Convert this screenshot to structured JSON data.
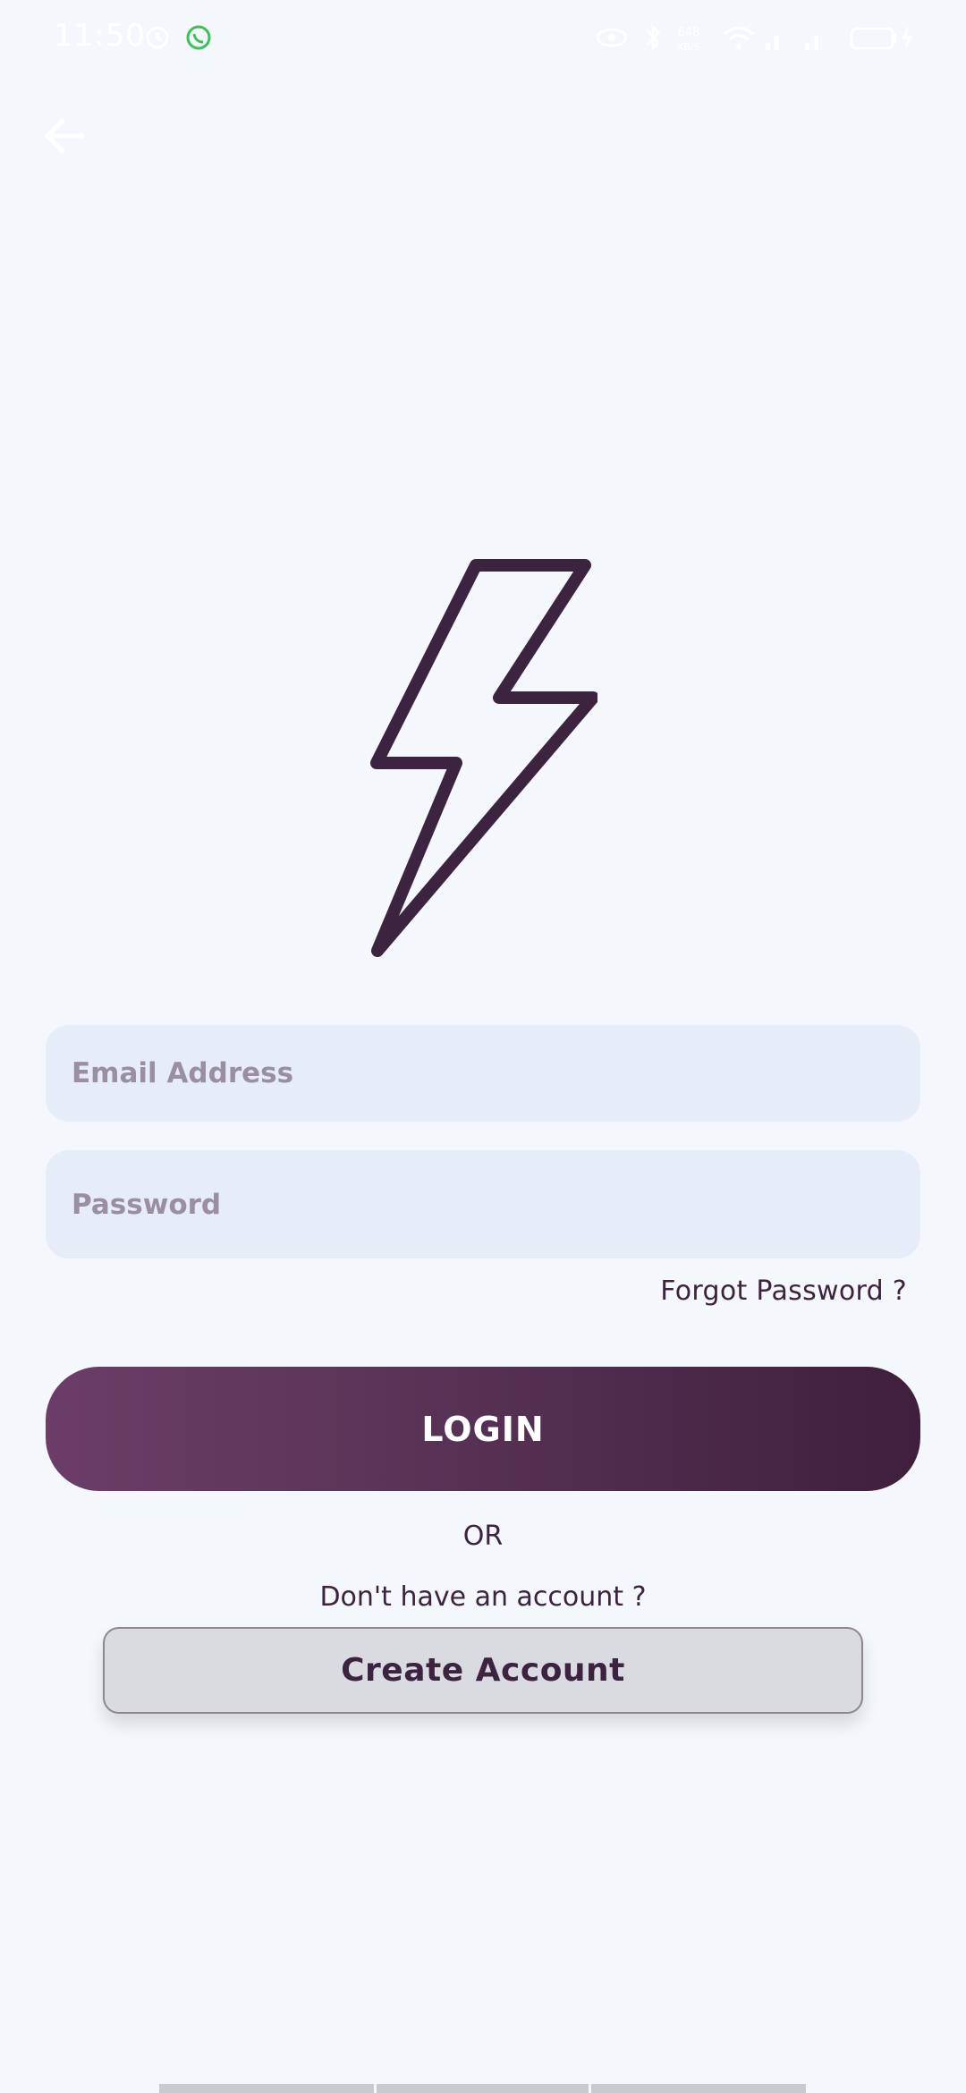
{
  "status_bar": {
    "time": "11:50",
    "icons": [
      "alarm-icon",
      "whatsapp-icon",
      "eye-icon",
      "bluetooth-icon",
      "data-speed-icon",
      "wifi-icon",
      "signal-icon",
      "signal-icon-2",
      "battery-icon",
      "charging-icon"
    ],
    "data_speed": "648 KB/S"
  },
  "header": {
    "back_icon": "arrow-left-icon"
  },
  "logo": {
    "icon": "lightning-bolt-icon",
    "color": "#3c2340"
  },
  "form": {
    "email_placeholder": "Email Address",
    "email_value": "",
    "password_placeholder": "Password",
    "password_value": "",
    "forgot_password_label": "Forgot Password ?",
    "login_label": "LOGIN",
    "or_label": "OR",
    "no_account_label": "Don't have an account ?",
    "create_account_label": "Create Account"
  },
  "colors": {
    "background": "#f4f7fb",
    "field_background": "#e6ecf8",
    "primary_dark": "#3f1f3d",
    "primary_light": "#6b3d68",
    "text": "#3c2340"
  }
}
